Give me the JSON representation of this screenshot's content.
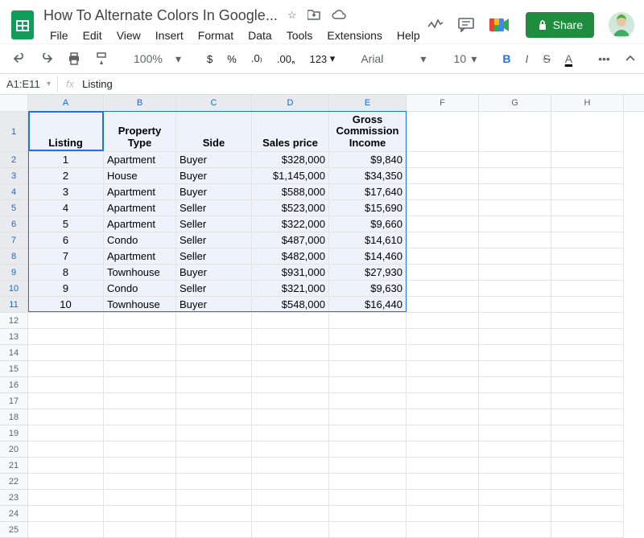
{
  "titlebar": {
    "doc_name": "How To Alternate Colors In Google...",
    "menus": [
      "File",
      "Edit",
      "View",
      "Insert",
      "Format",
      "Data",
      "Tools",
      "Extensions",
      "Help"
    ],
    "share": "Share"
  },
  "toolbar": {
    "zoom": "100%",
    "font": "Arial",
    "font_size": "10",
    "more_formats": "123"
  },
  "fxbar": {
    "range": "A1:E11",
    "value": "Listing"
  },
  "sheet": {
    "col_letters": [
      "A",
      "B",
      "C",
      "D",
      "E",
      "F",
      "G",
      "H"
    ],
    "selected_cols": 5,
    "header_row": [
      "Listing",
      "Property Type",
      "Side",
      "Sales price",
      "Gross Commission Income"
    ],
    "data_rows": [
      [
        "1",
        "Apartment",
        "Buyer",
        "$328,000",
        "$9,840"
      ],
      [
        "2",
        "House",
        "Buyer",
        "$1,145,000",
        "$34,350"
      ],
      [
        "3",
        "Apartment",
        "Buyer",
        "$588,000",
        "$17,640"
      ],
      [
        "4",
        "Apartment",
        "Seller",
        "$523,000",
        "$15,690"
      ],
      [
        "5",
        "Apartment",
        "Seller",
        "$322,000",
        "$9,660"
      ],
      [
        "6",
        "Condo",
        "Seller",
        "$487,000",
        "$14,610"
      ],
      [
        "7",
        "Apartment",
        "Seller",
        "$482,000",
        "$14,460"
      ],
      [
        "8",
        "Townhouse",
        "Buyer",
        "$931,000",
        "$27,930"
      ],
      [
        "9",
        "Condo",
        "Seller",
        "$321,000",
        "$9,630"
      ],
      [
        "10",
        "Townhouse",
        "Buyer",
        "$548,000",
        "$16,440"
      ]
    ],
    "empty_rows_after": 14,
    "total_data_rows": 10
  }
}
